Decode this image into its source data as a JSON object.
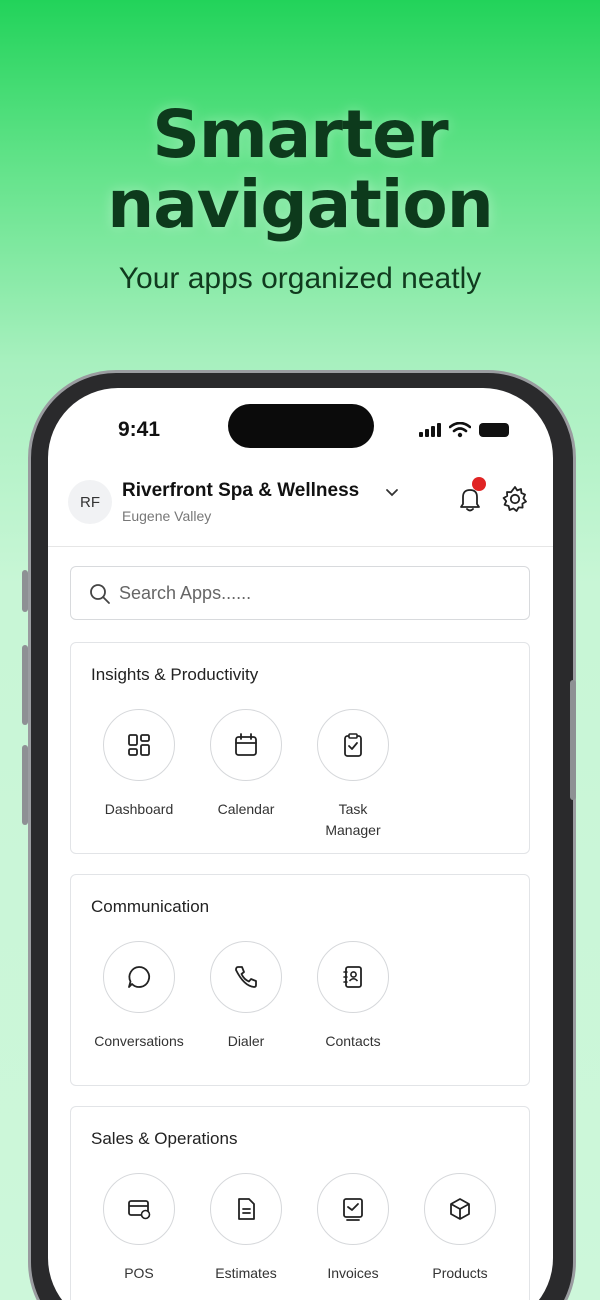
{
  "hero": {
    "title_line1": "Smarter",
    "title_line2": "navigation",
    "subtitle": "Your apps organized neatly"
  },
  "status_bar": {
    "time": "9:41"
  },
  "header": {
    "avatar_initials": "RF",
    "business_name": "Riverfront Spa & Wellness",
    "location": "Eugene Valley",
    "notification_badge_color": "#e02424"
  },
  "search": {
    "placeholder": "Search Apps......"
  },
  "sections": [
    {
      "title": "Insights & Productivity",
      "apps": [
        {
          "label": "Dashboard",
          "icon": "dashboard-icon"
        },
        {
          "label": "Calendar",
          "icon": "calendar-icon"
        },
        {
          "label": "Task Manager",
          "icon": "clipboard-check-icon"
        }
      ]
    },
    {
      "title": "Communication",
      "apps": [
        {
          "label": "Conversations",
          "icon": "chat-bubble-icon"
        },
        {
          "label": "Dialer",
          "icon": "phone-icon"
        },
        {
          "label": "Contacts",
          "icon": "contact-book-icon"
        }
      ]
    },
    {
      "title": "Sales & Operations",
      "apps": [
        {
          "label": "POS",
          "icon": "pos-card-icon"
        },
        {
          "label": "Estimates",
          "icon": "document-icon"
        },
        {
          "label": "Invoices",
          "icon": "invoice-icon"
        },
        {
          "label": "Products",
          "icon": "package-icon"
        }
      ]
    }
  ],
  "colors": {
    "background_top": "#22d35a",
    "background_bottom": "#cdf7da",
    "title_color": "#0d3a1c"
  }
}
